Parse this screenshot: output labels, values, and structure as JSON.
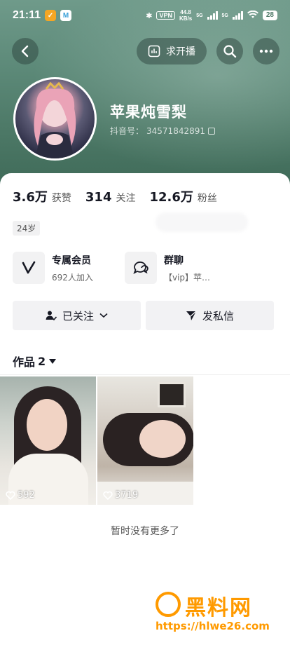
{
  "status_bar": {
    "time": "21:11",
    "vpn": "VPN",
    "speed_value": "44.8",
    "speed_unit": "KB/s",
    "network_1": "5G",
    "network_2": "5G",
    "battery": "28"
  },
  "nav": {
    "back_icon": "chevron-left-icon",
    "live_label": "求开播",
    "search_icon": "search-icon",
    "more_icon": "more-dots-icon"
  },
  "profile": {
    "nickname": "苹果炖雪梨",
    "id_label": "抖音号：",
    "id_value": "34571842891"
  },
  "stats": [
    {
      "num": "3.6万",
      "label": "获赞"
    },
    {
      "num": "314",
      "label": "关注"
    },
    {
      "num": "12.6万",
      "label": "粉丝"
    }
  ],
  "tags": {
    "age": "24岁"
  },
  "features": {
    "vip": {
      "title": "专属会员",
      "sub": "692人加入"
    },
    "group": {
      "title": "群聊",
      "sub": "【vip】苹…"
    }
  },
  "actions": {
    "follow_label": "已关注",
    "message_label": "发私信"
  },
  "works": {
    "tab_label": "作品",
    "count": "2",
    "videos": [
      {
        "likes": "592"
      },
      {
        "likes": "3719"
      }
    ],
    "end_text": "暂时没有更多了"
  },
  "watermark": {
    "title": "黑料网",
    "url": "https://hlwe26.com"
  },
  "colors": {
    "header_green": "#4c7866",
    "watermark_orange": "#ff9a00"
  }
}
